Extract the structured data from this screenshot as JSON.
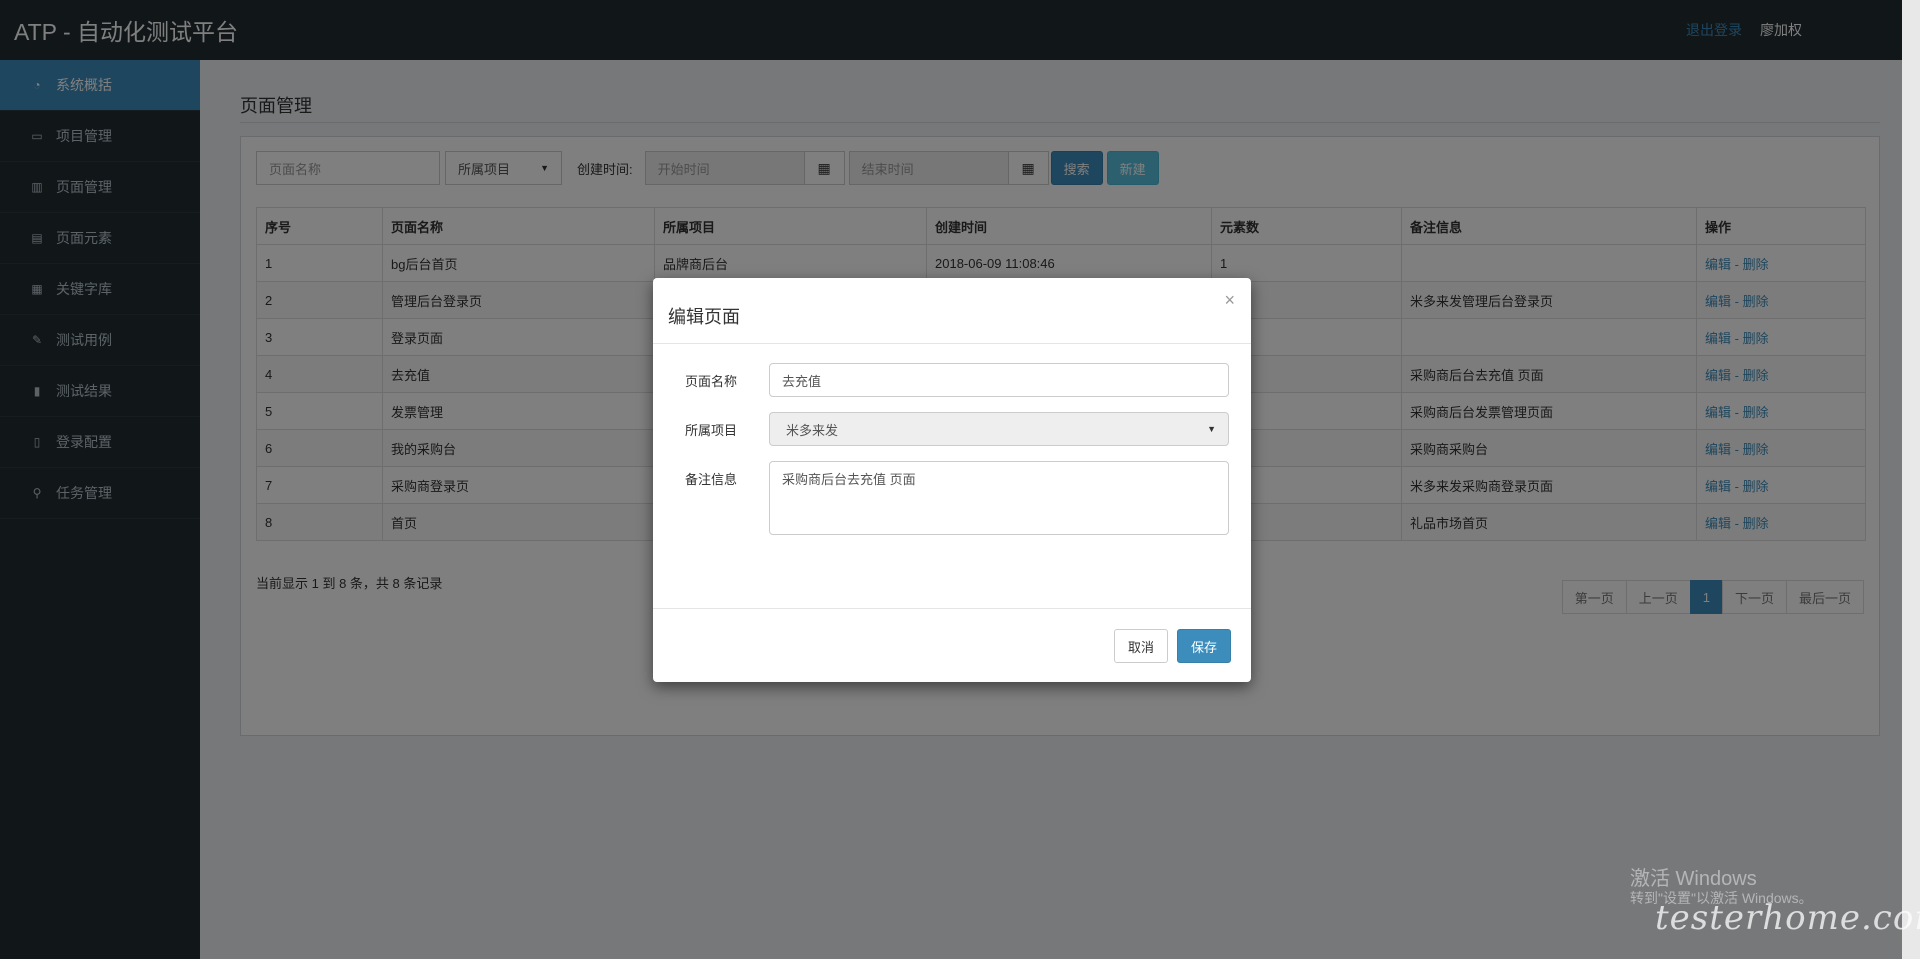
{
  "app": {
    "title": "ATP - 自动化测试平台",
    "logout": "退出登录",
    "user": "廖加权"
  },
  "sidebar": {
    "items": [
      {
        "label": "系统概括",
        "icon": "dashboard-icon",
        "glyph": "◔"
      },
      {
        "label": "项目管理",
        "icon": "desktop-icon",
        "glyph": "▭"
      },
      {
        "label": "页面管理",
        "icon": "bar-chart-icon",
        "glyph": "▥"
      },
      {
        "label": "页面元素",
        "icon": "list-alt-icon",
        "glyph": "▤"
      },
      {
        "label": "关键字库",
        "icon": "table-icon",
        "glyph": "▦"
      },
      {
        "label": "测试用例",
        "icon": "edit-icon",
        "glyph": "✎"
      },
      {
        "label": "测试结果",
        "icon": "file-icon",
        "glyph": "▮"
      },
      {
        "label": "登录配置",
        "icon": "book-icon",
        "glyph": "▯"
      },
      {
        "label": "任务管理",
        "icon": "sitemap-icon",
        "glyph": "⚲"
      }
    ]
  },
  "page": {
    "title": "页面管理"
  },
  "filters": {
    "name_placeholder": "页面名称",
    "project_select": "所属项目",
    "created_label": "创建时间:",
    "start_placeholder": "开始时间",
    "end_placeholder": "结束时间",
    "search": "搜索",
    "create": "新建"
  },
  "table": {
    "headers": [
      "序号",
      "页面名称",
      "所属项目",
      "创建时间",
      "元素数",
      "备注信息",
      "操作"
    ],
    "rows": [
      {
        "no": "1",
        "name": "bg后台首页",
        "project": "品牌商后台",
        "created": "2018-06-09 11:08:46",
        "count": "1",
        "note": "",
        "edit": "编辑",
        "sep": " - ",
        "del": "删除"
      },
      {
        "no": "2",
        "name": "管理后台登录页",
        "project": "",
        "created": "",
        "count": "",
        "note": "米多来发管理后台登录页",
        "edit": "编辑",
        "sep": " - ",
        "del": "删除"
      },
      {
        "no": "3",
        "name": "登录页面",
        "project": "",
        "created": "",
        "count": "",
        "note": "",
        "edit": "编辑",
        "sep": " - ",
        "del": "删除"
      },
      {
        "no": "4",
        "name": "去充值",
        "project": "",
        "created": "",
        "count": "",
        "note": "采购商后台去充值 页面",
        "edit": "编辑",
        "sep": " - ",
        "del": "删除"
      },
      {
        "no": "5",
        "name": "发票管理",
        "project": "",
        "created": "",
        "count": "",
        "note": "采购商后台发票管理页面",
        "edit": "编辑",
        "sep": " - ",
        "del": "删除"
      },
      {
        "no": "6",
        "name": "我的采购台",
        "project": "",
        "created": "",
        "count": "",
        "note": "采购商采购台",
        "edit": "编辑",
        "sep": " - ",
        "del": "删除"
      },
      {
        "no": "7",
        "name": "采购商登录页",
        "project": "",
        "created": "",
        "count": "",
        "note": "米多来发采购商登录页面",
        "edit": "编辑",
        "sep": " - ",
        "del": "删除"
      },
      {
        "no": "8",
        "name": "首页",
        "project": "",
        "created": "",
        "count": "",
        "note": "礼品市场首页",
        "edit": "编辑",
        "sep": " - ",
        "del": "删除"
      }
    ]
  },
  "summary": "当前显示 1 到 8 条，共 8 条记录",
  "pager": {
    "first": "第一页",
    "prev": "上一页",
    "current": "1",
    "next": "下一页",
    "last": "最后一页"
  },
  "modal": {
    "title": "编辑页面",
    "close": "×",
    "name_label": "页面名称",
    "name_value": "去充值",
    "project_label": "所属项目",
    "project_value": "米多来发",
    "note_label": "备注信息",
    "note_value": "采购商后台去充值 页面",
    "cancel": "取消",
    "save": "保存"
  },
  "watermark": {
    "activate": "激活 Windows",
    "hint": "转到\"设置\"以激活 Windows。",
    "site": "testerhome.com"
  }
}
